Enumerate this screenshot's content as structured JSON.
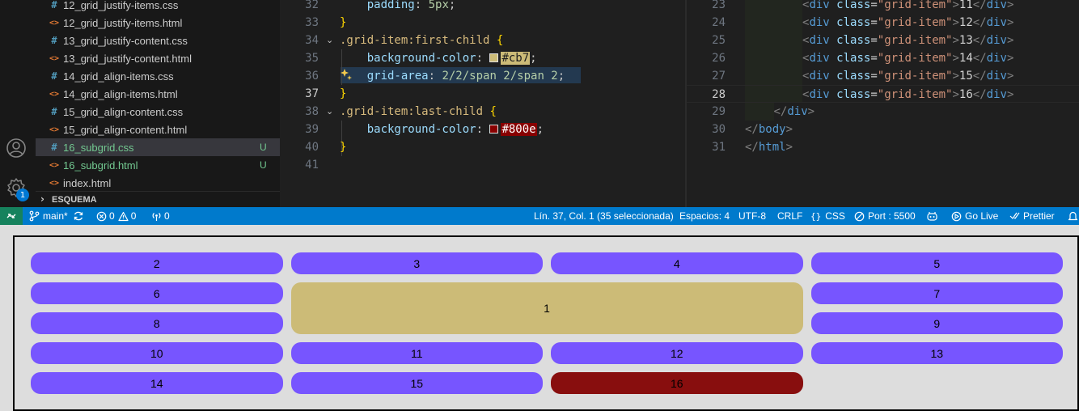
{
  "explorer": {
    "files": [
      {
        "name": "12_grid_justify-items.css",
        "type": "css",
        "status": ""
      },
      {
        "name": "12_grid_justify-items.html",
        "type": "html",
        "status": ""
      },
      {
        "name": "13_grid_justify-content.css",
        "type": "css",
        "status": ""
      },
      {
        "name": "13_grid_justify-content.html",
        "type": "html",
        "status": ""
      },
      {
        "name": "14_grid_align-items.css",
        "type": "css",
        "status": ""
      },
      {
        "name": "14_grid_align-items.html",
        "type": "html",
        "status": ""
      },
      {
        "name": "15_grid_align-content.css",
        "type": "css",
        "status": ""
      },
      {
        "name": "15_grid_align-content.html",
        "type": "html",
        "status": ""
      },
      {
        "name": "16_subgrid.css",
        "type": "css",
        "status": "U"
      },
      {
        "name": "16_subgrid.html",
        "type": "html",
        "status": "U"
      },
      {
        "name": "index.html",
        "type": "html",
        "status": ""
      }
    ],
    "file_icons": {
      "css": "#",
      "html": "<>"
    },
    "outline_label": "ESQUEMA"
  },
  "activity": {
    "settings_badge": "1"
  },
  "css_editor": {
    "lines": [
      {
        "num": "32",
        "tokens": [
          {
            "t": "    ",
            "c": "ws"
          },
          {
            "t": "padding",
            "c": "prop"
          },
          {
            "t": ": ",
            "c": "punct"
          },
          {
            "t": "5px",
            "c": "val"
          },
          {
            "t": ";",
            "c": "punct"
          }
        ]
      },
      {
        "num": "33",
        "tokens": [
          {
            "t": "}",
            "c": "brace"
          }
        ]
      },
      {
        "num": "34",
        "fold": true,
        "tokens": [
          {
            "t": ".grid-item:first-child ",
            "c": "sel"
          },
          {
            "t": "{",
            "c": "brace"
          }
        ]
      },
      {
        "num": "35",
        "tokens": [
          {
            "t": "    ",
            "c": "ws"
          },
          {
            "t": "background-color",
            "c": "prop"
          },
          {
            "t": ": ",
            "c": "punct"
          },
          {
            "t": "#cb7",
            "c": "val",
            "swatch": "#ccbb77"
          },
          {
            "t": ";",
            "c": "punct"
          }
        ]
      },
      {
        "num": "36",
        "tokens": [
          {
            "t": "    ",
            "c": "ws"
          },
          {
            "t": "grid-area",
            "c": "prop"
          },
          {
            "t": ": ",
            "c": "punct"
          },
          {
            "t": "2/2/span 2/span 2",
            "c": "val"
          },
          {
            "t": ";",
            "c": "punct"
          }
        ]
      },
      {
        "num": "37",
        "current": true,
        "tokens": [
          {
            "t": "}",
            "c": "brace"
          }
        ]
      },
      {
        "num": "38",
        "fold": true,
        "tokens": [
          {
            "t": ".grid-item:last-child ",
            "c": "sel"
          },
          {
            "t": "{",
            "c": "brace"
          }
        ]
      },
      {
        "num": "39",
        "tokens": [
          {
            "t": "    ",
            "c": "ws"
          },
          {
            "t": "background-color",
            "c": "prop"
          },
          {
            "t": ": ",
            "c": "punct"
          },
          {
            "t": "#800e",
            "c": "val",
            "swatch": "#880000"
          },
          {
            "t": ";",
            "c": "punct"
          }
        ]
      },
      {
        "num": "40",
        "tokens": [
          {
            "t": "}",
            "c": "brace"
          }
        ]
      },
      {
        "num": "41",
        "tokens": []
      }
    ]
  },
  "html_editor": {
    "lines": [
      {
        "num": "23",
        "indent": 2,
        "tag": "div",
        "cls": "grid-item",
        "text": "11"
      },
      {
        "num": "24",
        "indent": 2,
        "tag": "div",
        "cls": "grid-item",
        "text": "12"
      },
      {
        "num": "25",
        "indent": 2,
        "tag": "div",
        "cls": "grid-item",
        "text": "13"
      },
      {
        "num": "26",
        "indent": 2,
        "tag": "div",
        "cls": "grid-item",
        "text": "14"
      },
      {
        "num": "27",
        "indent": 2,
        "tag": "div",
        "cls": "grid-item",
        "text": "15"
      },
      {
        "num": "28",
        "indent": 2,
        "tag": "div",
        "cls": "grid-item",
        "text": "16",
        "current": true
      },
      {
        "num": "29",
        "indent": 1,
        "close": "div"
      },
      {
        "num": "30",
        "indent": 0,
        "close": "body"
      },
      {
        "num": "31",
        "indent": 0,
        "close": "html"
      }
    ]
  },
  "status_bar": {
    "branch": "main*",
    "errors": "0",
    "warnings": "0",
    "ports": "0",
    "cursor": "Lín. 37, Col. 1 (35 seleccionada)",
    "spaces": "Espacios: 4",
    "encoding": "UTF-8",
    "eol": "CRLF",
    "language": "CSS",
    "port": "Port : 5500",
    "go_live": "Go Live",
    "prettier": "Prettier"
  },
  "preview": {
    "items": [
      {
        "text": "1",
        "color": "#ccbb77"
      },
      {
        "text": "2",
        "color": "#7755ff"
      },
      {
        "text": "3",
        "color": "#7755ff"
      },
      {
        "text": "4",
        "color": "#7755ff"
      },
      {
        "text": "5",
        "color": "#7755ff"
      },
      {
        "text": "6",
        "color": "#7755ff"
      },
      {
        "text": "7",
        "color": "#7755ff"
      },
      {
        "text": "8",
        "color": "#7755ff"
      },
      {
        "text": "9",
        "color": "#7755ff"
      },
      {
        "text": "10",
        "color": "#7755ff"
      },
      {
        "text": "11",
        "color": "#7755ff"
      },
      {
        "text": "12",
        "color": "#7755ff"
      },
      {
        "text": "13",
        "color": "#7755ff"
      },
      {
        "text": "14",
        "color": "#7755ff"
      },
      {
        "text": "15",
        "color": "#7755ff"
      },
      {
        "text": "16",
        "color": "#880e0e"
      }
    ]
  }
}
